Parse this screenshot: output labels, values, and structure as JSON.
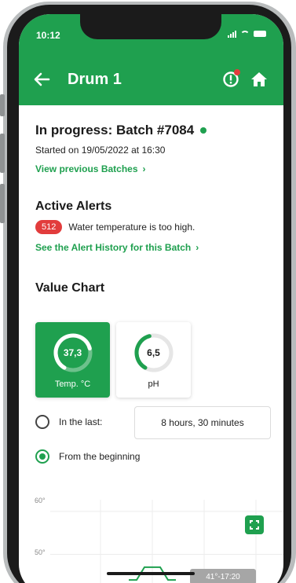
{
  "status": {
    "time": "10:12"
  },
  "header": {
    "title": "Drum 1"
  },
  "batch": {
    "title": "In progress: Batch #7084",
    "started": "Started on 19/05/2022 at 16:30",
    "view_previous": "View previous Batches",
    "link_arrow": "›"
  },
  "alerts": {
    "heading": "Active Alerts",
    "badge": "512",
    "text": "Water temperature is too high.",
    "history_link": "See the Alert History for this Batch",
    "link_arrow": "›"
  },
  "value_chart": {
    "heading": "Value Chart",
    "cards": [
      {
        "value": "37,3",
        "label": "Temp. °C",
        "level": 0.75
      },
      {
        "value": "6,5",
        "label": "pH",
        "level": 0.45
      }
    ]
  },
  "range": {
    "option_last_label": "In the last:",
    "duration_value": "8 hours, 30 minutes",
    "option_beginning_label": "From the beginning",
    "selected": "beginning"
  },
  "chart_data": {
    "type": "line",
    "ytick_labels": [
      "60°",
      "50°"
    ],
    "tooltip": "41°-17:20",
    "series": [
      {
        "values": [
          44,
          44,
          47,
          47,
          44,
          44
        ]
      }
    ],
    "ylim": [
      40,
      62
    ]
  },
  "colors": {
    "accent": "#1fa04f",
    "alert": "#e23c3c"
  }
}
